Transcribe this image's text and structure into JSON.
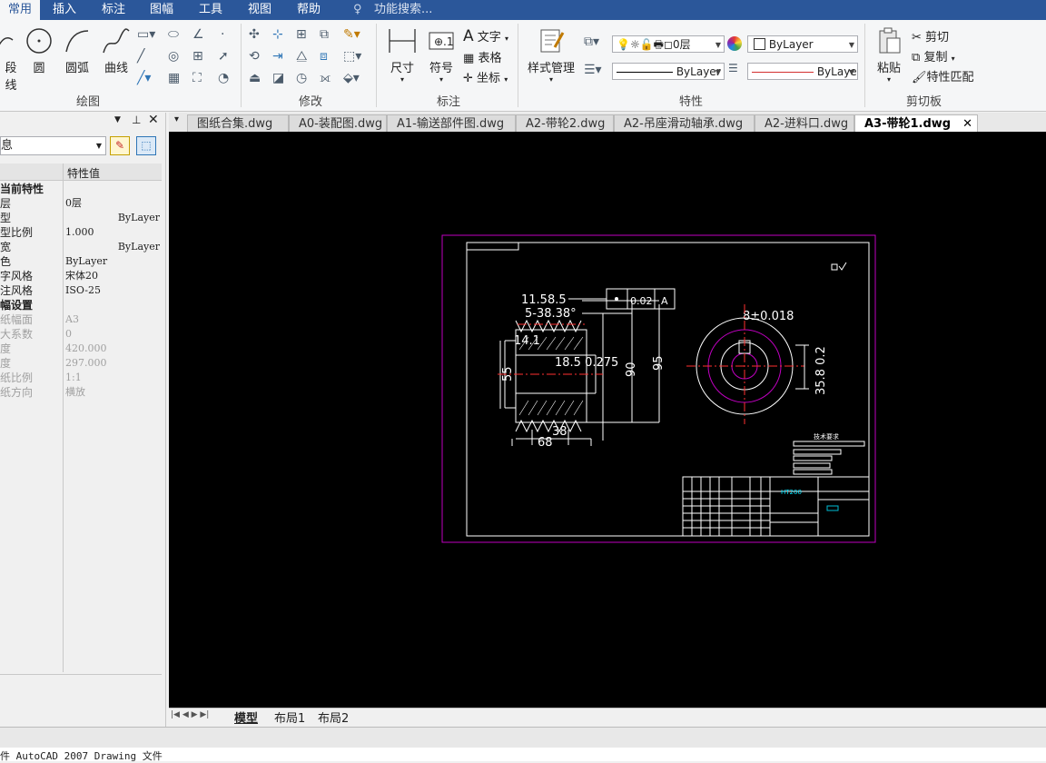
{
  "menu": {
    "items": [
      "常用",
      "插入",
      "标注",
      "图幅",
      "工具",
      "视图",
      "帮助"
    ],
    "search_placeholder": "功能搜索..."
  },
  "ribbon": {
    "draw": {
      "label": "绘图",
      "line": "段线",
      "circle": "圆",
      "arc": "圆弧",
      "curve": "曲线"
    },
    "modify": {
      "label": "修改"
    },
    "annotate": {
      "label": "标注",
      "dimension": "尺寸",
      "symbol": "符号",
      "text": "文字",
      "table": "表格",
      "coord": "坐标"
    },
    "properties": {
      "label": "特性",
      "style_manager": "样式管理",
      "layer": "0层",
      "color": "ByLayer",
      "linetype": "ByLayer",
      "lineweight": "ByLaye"
    },
    "clipboard": {
      "label": "剪切板",
      "paste": "粘贴",
      "cut": "剪切",
      "copy": "复制",
      "match": "特性匹配"
    }
  },
  "properties_panel": {
    "selector": "息",
    "col_value": "特性值",
    "rows": [
      {
        "k": "当前特性",
        "v": "",
        "type": "hdr"
      },
      {
        "k": "层",
        "v": "0层",
        "type": "normal"
      },
      {
        "k": "型",
        "v": "ByLayer",
        "type": "normal"
      },
      {
        "k": "型比例",
        "v": "1.000",
        "type": "normal"
      },
      {
        "k": "宽",
        "v": "ByLayer",
        "type": "normal"
      },
      {
        "k": "色",
        "v": "ByLayer",
        "type": "normal"
      },
      {
        "k": "字风格",
        "v": "宋体20",
        "type": "normal"
      },
      {
        "k": "注风格",
        "v": "ISO-25",
        "type": "normal"
      },
      {
        "k": "幅设置",
        "v": "",
        "type": "hdr"
      },
      {
        "k": "纸幅面",
        "v": "A3",
        "type": "gray"
      },
      {
        "k": "大系数",
        "v": "0",
        "type": "gray"
      },
      {
        "k": "度",
        "v": "420.000",
        "type": "gray"
      },
      {
        "k": "度",
        "v": "297.000",
        "type": "gray"
      },
      {
        "k": "纸比例",
        "v": "1:1",
        "type": "gray"
      },
      {
        "k": "纸方向",
        "v": "横放",
        "type": "gray"
      }
    ]
  },
  "doc_tabs": [
    "图纸合集.dwg",
    "A0-装配图.dwg",
    "A1-输送部件图.dwg",
    "A2-带轮2.dwg",
    "A2-吊座滑动轴承.dwg",
    "A2-进料口.dwg",
    "A3-带轮1.dwg"
  ],
  "active_tab": 6,
  "layout_tabs": [
    "模型",
    "布局1",
    "布局2"
  ],
  "drawing": {
    "dims": [
      "11.58.5",
      "5-38.38°",
      "14.1",
      "55",
      "18.5 0.275",
      "90",
      "95",
      "68",
      "38",
      "8±0.018",
      "35.8 0.2",
      "0.02",
      "A",
      "HT200",
      "技术要求"
    ]
  },
  "command_line": "件 AutoCAD 2007 Drawing 文件"
}
